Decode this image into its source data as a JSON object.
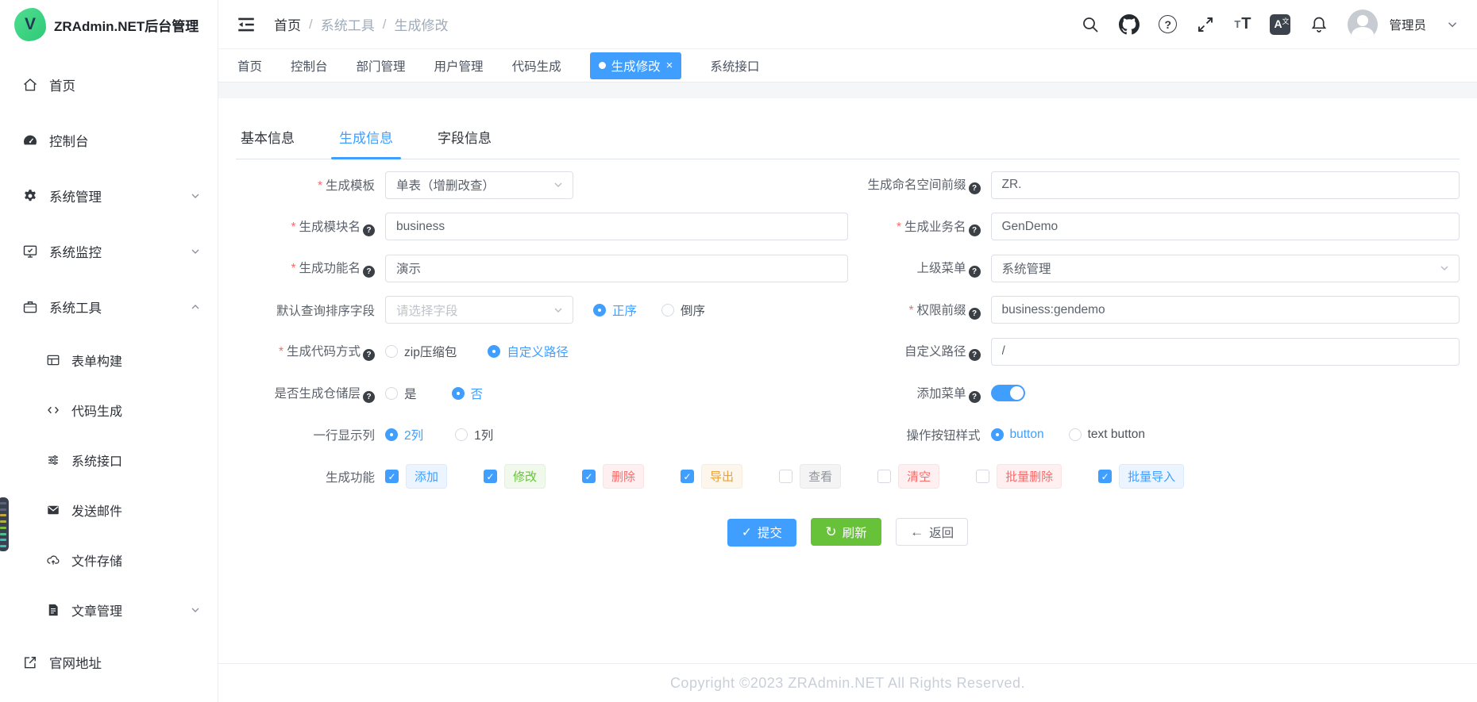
{
  "app": {
    "title": "ZRAdmin.NET后台管理",
    "logo_letter": "V"
  },
  "sidebar": {
    "items": [
      {
        "label": "首页",
        "icon": "home-icon"
      },
      {
        "label": "控制台",
        "icon": "dashboard-icon"
      },
      {
        "label": "系统管理",
        "icon": "gear-icon",
        "expandable": true,
        "expanded": false
      },
      {
        "label": "系统监控",
        "icon": "monitor-icon",
        "expandable": true,
        "expanded": false
      },
      {
        "label": "系统工具",
        "icon": "briefcase-icon",
        "expandable": true,
        "expanded": true,
        "children": [
          {
            "label": "表单构建",
            "icon": "form-icon"
          },
          {
            "label": "代码生成",
            "icon": "code-icon"
          },
          {
            "label": "系统接口",
            "icon": "sliders-icon"
          },
          {
            "label": "发送邮件",
            "icon": "mail-icon"
          },
          {
            "label": "文件存储",
            "icon": "cloud-upload-icon"
          },
          {
            "label": "文章管理",
            "icon": "article-icon",
            "expandable": true,
            "expanded": false
          }
        ]
      },
      {
        "label": "官网地址",
        "icon": "external-link-icon"
      }
    ]
  },
  "header": {
    "breadcrumb": {
      "items": [
        "首页",
        "系统工具",
        "生成修改"
      ],
      "separator": "/"
    },
    "icons": [
      "search-icon",
      "github-icon",
      "question-icon",
      "fullscreen-icon",
      "font-size-icon",
      "translate-icon",
      "bell-icon"
    ],
    "user": {
      "name": "管理员"
    }
  },
  "tags_bar": {
    "tabs": [
      {
        "label": "首页"
      },
      {
        "label": "控制台"
      },
      {
        "label": "部门管理"
      },
      {
        "label": "用户管理"
      },
      {
        "label": "代码生成"
      },
      {
        "label": "生成修改",
        "active": true,
        "close_glyph": "×"
      },
      {
        "label": "系统接口"
      }
    ]
  },
  "form_tabs": [
    {
      "label": "基本信息",
      "active": false
    },
    {
      "label": "生成信息",
      "active": true
    },
    {
      "label": "字段信息",
      "active": false
    }
  ],
  "form": {
    "left": {
      "gen_template": {
        "label": "生成模板",
        "required": true,
        "value": "单表（增删改查）"
      },
      "module_name": {
        "label": "生成模块名",
        "required": true,
        "help": true,
        "value": "business"
      },
      "function_name": {
        "label": "生成功能名",
        "required": true,
        "help": true,
        "value": "演示"
      },
      "sort_field": {
        "label": "默认查询排序字段",
        "placeholder": "请选择字段",
        "options": [
          {
            "label": "正序",
            "checked": true
          },
          {
            "label": "倒序",
            "checked": false
          }
        ]
      },
      "code_method": {
        "label": "生成代码方式",
        "required": true,
        "help": true,
        "options": [
          {
            "label": "zip压缩包",
            "checked": false
          },
          {
            "label": "自定义路径",
            "checked": true
          }
        ]
      },
      "repository": {
        "label": "是否生成仓储层",
        "help": true,
        "options": [
          {
            "label": "是",
            "checked": false
          },
          {
            "label": "否",
            "checked": true
          }
        ]
      },
      "columns_per_row": {
        "label": "一行显示列",
        "options": [
          {
            "label": "2列",
            "checked": true
          },
          {
            "label": "1列",
            "checked": false
          }
        ]
      },
      "functions": {
        "label": "生成功能",
        "items": [
          {
            "label": "添加",
            "checked": true,
            "color": "blue"
          },
          {
            "label": "修改",
            "checked": true,
            "color": "green"
          },
          {
            "label": "删除",
            "checked": true,
            "color": "red"
          },
          {
            "label": "导出",
            "checked": true,
            "color": "orange"
          },
          {
            "label": "查看",
            "checked": false,
            "color": "gray"
          },
          {
            "label": "清空",
            "checked": false,
            "color": "red"
          },
          {
            "label": "批量删除",
            "checked": false,
            "color": "red"
          },
          {
            "label": "批量导入",
            "checked": true,
            "color": "blue"
          }
        ]
      }
    },
    "right": {
      "namespace_prefix": {
        "label": "生成命名空间前缀",
        "help": true,
        "value": "ZR."
      },
      "business_name": {
        "label": "生成业务名",
        "required": true,
        "help": true,
        "value": "GenDemo"
      },
      "parent_menu": {
        "label": "上级菜单",
        "help": true,
        "value": "系统管理"
      },
      "permission_prefix": {
        "label": "权限前缀",
        "required": true,
        "help": true,
        "value": "business:gendemo"
      },
      "custom_path": {
        "label": "自定义路径",
        "help": true,
        "value": "/"
      },
      "add_menu": {
        "label": "添加菜单",
        "help": true,
        "checked": true
      },
      "button_style": {
        "label": "操作按钮样式",
        "options": [
          {
            "label": "button",
            "checked": true
          },
          {
            "label": "text button",
            "checked": false
          }
        ]
      }
    },
    "actions": {
      "submit": "提交",
      "refresh": "刷新",
      "back": "返回"
    }
  },
  "footer": {
    "copyright": "Copyright ©2023 ZRAdmin.NET All Rights Reserved."
  },
  "colors": {
    "primary": "#409eff",
    "success": "#67c23a",
    "danger": "#f56c6c",
    "warning": "#e6a23c",
    "info": "#909399"
  }
}
